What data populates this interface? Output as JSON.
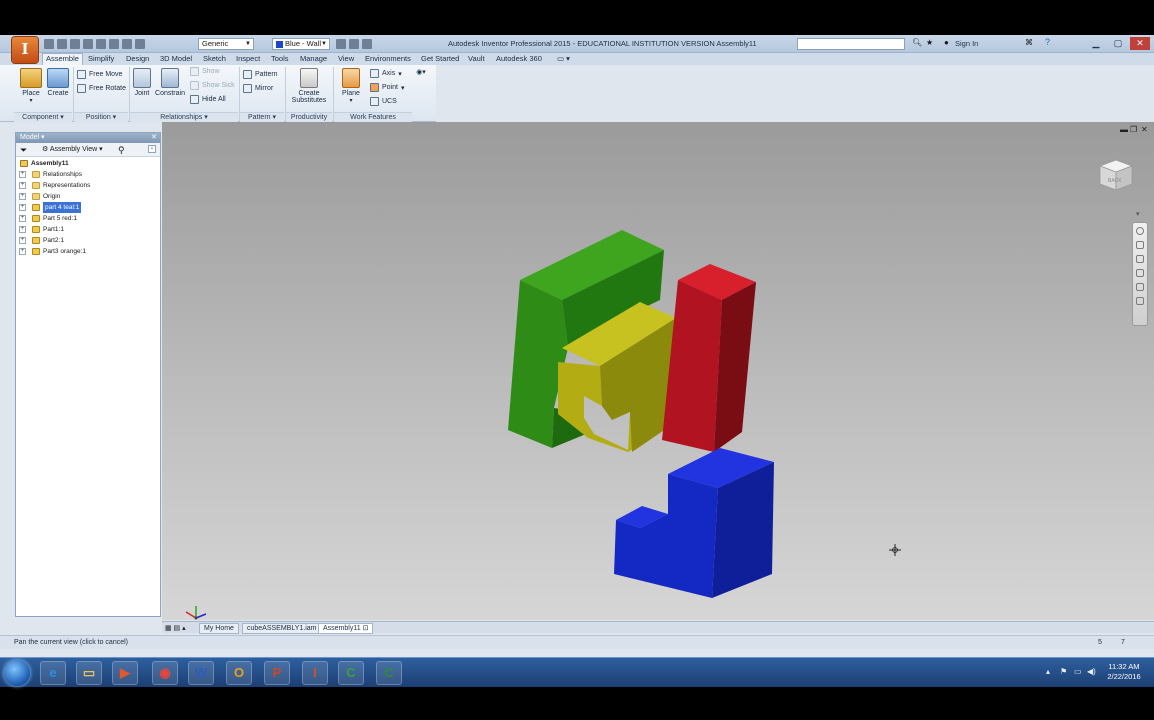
{
  "app": {
    "title": "Autodesk Inventor Professional 2015 - EDUCATIONAL INSTITUTION VERSION    Assembly11",
    "app_button_letter": "I",
    "appearance_combo": "Generic",
    "color_combo": "Blue - Wall",
    "sign_in": "Sign In",
    "tabs": [
      "Assemble",
      "Simplify",
      "Design",
      "3D Model",
      "Sketch",
      "Inspect",
      "Tools",
      "Manage",
      "View",
      "Environments",
      "Get Started",
      "Vault",
      "Autodesk 360"
    ]
  },
  "ribbon": {
    "component": {
      "place": "Place",
      "create": "Create",
      "label": "Component"
    },
    "position": {
      "free_move": "Free Move",
      "free_rotate": "Free Rotate",
      "label": "Position"
    },
    "relationships": {
      "joint": "Joint",
      "constrain": "Constrain",
      "show": "Show",
      "show_sick": "Show Sick",
      "hide_all": "Hide All",
      "label": "Relationships"
    },
    "pattern": {
      "pattern": "Pattern",
      "mirror": "Mirror",
      "label": "Pattern"
    },
    "productivity": {
      "create": "Create",
      "substitutes": "Substitutes",
      "label": "Productivity"
    },
    "work_features": {
      "plane": "Plane",
      "axis": "Axis",
      "point": "Point",
      "ucs": "UCS",
      "label": "Work Features"
    }
  },
  "browser": {
    "title": "Model",
    "view_mode": "Assembly View",
    "root": "Assembly11",
    "items": [
      {
        "label": "Relationships",
        "kind": "folder",
        "selected": false
      },
      {
        "label": "Representations",
        "kind": "folder",
        "selected": false
      },
      {
        "label": "Origin",
        "kind": "folder",
        "selected": false
      },
      {
        "label": "part 4 teal:1",
        "kind": "part",
        "selected": true
      },
      {
        "label": "Part 5 red:1",
        "kind": "part",
        "selected": false
      },
      {
        "label": "Part1:1",
        "kind": "part",
        "selected": false
      },
      {
        "label": "Part2:1",
        "kind": "part",
        "selected": false
      },
      {
        "label": "Part3 orange:1",
        "kind": "part",
        "selected": false
      }
    ]
  },
  "viewcube": {
    "face_label": "BACK"
  },
  "doc_tabs": [
    "My Home",
    "cubeASSEMBLY1.iam",
    "Assembly11"
  ],
  "status": {
    "message": "Pan the current view (click to cancel)",
    "count_a": "5",
    "count_b": "7"
  },
  "taskbar": {
    "apps": [
      {
        "name": "ie",
        "glyph": "e",
        "color": "#2a8fe0"
      },
      {
        "name": "explorer",
        "glyph": "▭",
        "color": "#e8c25a"
      },
      {
        "name": "media",
        "glyph": "▶",
        "color": "#e2572b"
      },
      {
        "name": "chrome",
        "glyph": "◉",
        "color": "#e8473b"
      },
      {
        "name": "word",
        "glyph": "W",
        "color": "#2b5fb4"
      },
      {
        "name": "outlook",
        "glyph": "O",
        "color": "#e8a21c"
      },
      {
        "name": "powerpoint",
        "glyph": "P",
        "color": "#d04525"
      },
      {
        "name": "inventor",
        "glyph": "I",
        "color": "#d2511c"
      },
      {
        "name": "camtasia",
        "glyph": "C",
        "color": "#3aa23a"
      },
      {
        "name": "camtasia-recorder",
        "glyph": "C",
        "color": "#2f8f2f"
      }
    ],
    "time": "11:32 AM",
    "date": "2/22/2016"
  }
}
